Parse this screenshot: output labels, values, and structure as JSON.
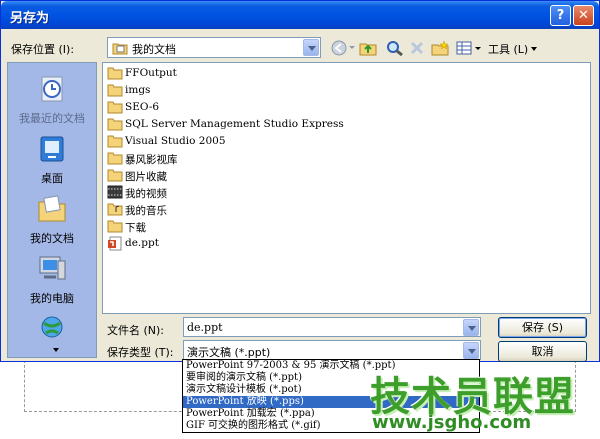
{
  "window": {
    "title": "另存为",
    "help_glyph": "?",
    "close_glyph": "✕"
  },
  "toolbar": {
    "location_label": "保存位置 (I):",
    "location_value": "我的文档",
    "tools_label": "工具 (L)"
  },
  "places": [
    {
      "label": "我最近的文档",
      "icon": "recent-docs-icon"
    },
    {
      "label": "桌面",
      "icon": "desktop-icon"
    },
    {
      "label": "我的文档",
      "icon": "my-documents-icon"
    },
    {
      "label": "我的电脑",
      "icon": "my-computer-icon"
    },
    {
      "label": "",
      "icon": "network-places-icon"
    }
  ],
  "files": [
    {
      "name": "FFOutput",
      "type": "folder"
    },
    {
      "name": "imgs",
      "type": "folder"
    },
    {
      "name": "SEO-6",
      "type": "folder"
    },
    {
      "name": "SQL Server Management Studio Express",
      "type": "folder"
    },
    {
      "name": "Visual Studio 2005",
      "type": "folder"
    },
    {
      "name": "暴风影视库",
      "type": "folder"
    },
    {
      "name": "图片收藏",
      "type": "folder"
    },
    {
      "name": "我的视频",
      "type": "video-folder"
    },
    {
      "name": "我的音乐",
      "type": "folder"
    },
    {
      "name": "下载",
      "type": "folder"
    },
    {
      "name": "de.ppt",
      "type": "ppt"
    }
  ],
  "filename": {
    "label": "文件名 (N):",
    "value": "de.ppt"
  },
  "filetype": {
    "label": "保存类型 (T):",
    "value": "演示文稿 (*.ppt)",
    "options": [
      "PowerPoint 97-2003 & 95 演示文稿 (*.ppt)",
      "要审阅的演示文稿 (*.ppt)",
      "演示文稿设计模板 (*.pot)",
      "PowerPoint 放映 (*.pps)",
      "PowerPoint 加载宏 (*.ppa)",
      "GIF 可交换的图形格式 (*.gif)"
    ],
    "selected_index": 3
  },
  "buttons": {
    "save": "保存 (S)",
    "cancel": "取消"
  },
  "watermark": {
    "title": "技术员联盟",
    "url": "www.jsgho.com"
  },
  "colors": {
    "titlebar": "#0054e3",
    "selection": "#316ac5",
    "places_bg": "#a4b8e8",
    "dialog_bg": "#ece9d8"
  }
}
